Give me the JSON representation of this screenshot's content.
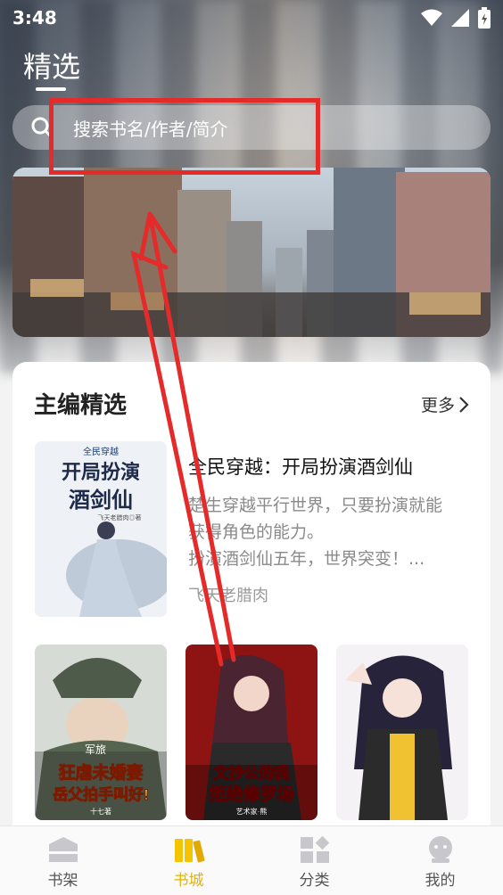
{
  "status": {
    "time": "3:48"
  },
  "header": {
    "title": "精选"
  },
  "search": {
    "placeholder": "搜索书名/作者/简介"
  },
  "section": {
    "title": "主编精选",
    "more": "更多"
  },
  "featured": {
    "title": "全民穿越：开局扮演酒剑仙",
    "desc_lines": [
      "楚生穿越平行世界，只要扮演就能",
      "获得角色的能力。",
      "扮演酒剑仙五年，世界突变！..."
    ],
    "author": "飞天老腊肉",
    "cover_top": "全民穿越",
    "cover_title_1": "开局扮演",
    "cover_title_2": "酒剑仙",
    "cover_author": "飞天老腊肉◎著"
  },
  "books": [
    {
      "tag": "军旅",
      "line1": "狂虐未婚妻",
      "line2": "岳父拍手叫好!",
      "author": "十七著"
    },
    {
      "line1": "文抄公的我",
      "line2": "拒绝修罗场",
      "author": "艺术家·熊"
    },
    {}
  ],
  "tabs": [
    {
      "label": "书架",
      "icon": "bookshelf-icon"
    },
    {
      "label": "书城",
      "icon": "bookstore-icon",
      "active": true
    },
    {
      "label": "分类",
      "icon": "category-icon"
    },
    {
      "label": "我的",
      "icon": "profile-icon"
    }
  ],
  "colors": {
    "accent": "#e7b300",
    "annotation": "#e52a2a"
  }
}
